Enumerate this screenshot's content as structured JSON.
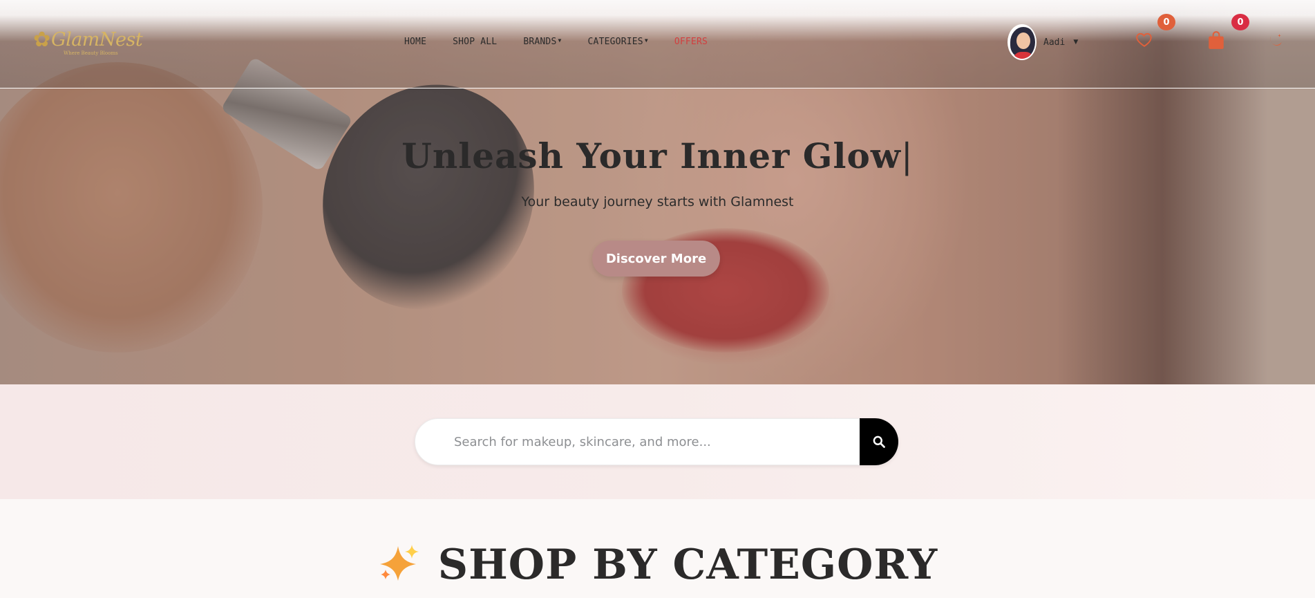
{
  "brand": {
    "name": "GlamNest",
    "tagline": "Where Beauty Blooms"
  },
  "nav": {
    "links": [
      {
        "label": "HOME"
      },
      {
        "label": "SHOP ALL"
      },
      {
        "label": "BRANDS"
      },
      {
        "label": "CATEGORIES"
      },
      {
        "label": "OFFERS"
      }
    ]
  },
  "user": {
    "name": "Aadi"
  },
  "wishlist": {
    "count": "0",
    "badge_color": "#e0603b"
  },
  "cart": {
    "count": "0",
    "badge_color": "#d92d43"
  },
  "accent": "#e0603b",
  "hero": {
    "title": "Unleash Your Inner Glow",
    "subtitle": "Your beauty journey starts with Glamnest",
    "cta_label": "Discover More"
  },
  "search": {
    "placeholder": "Search for makeup, skincare, and more..."
  },
  "category": {
    "heading": "SHOP BY CATEGORY"
  }
}
